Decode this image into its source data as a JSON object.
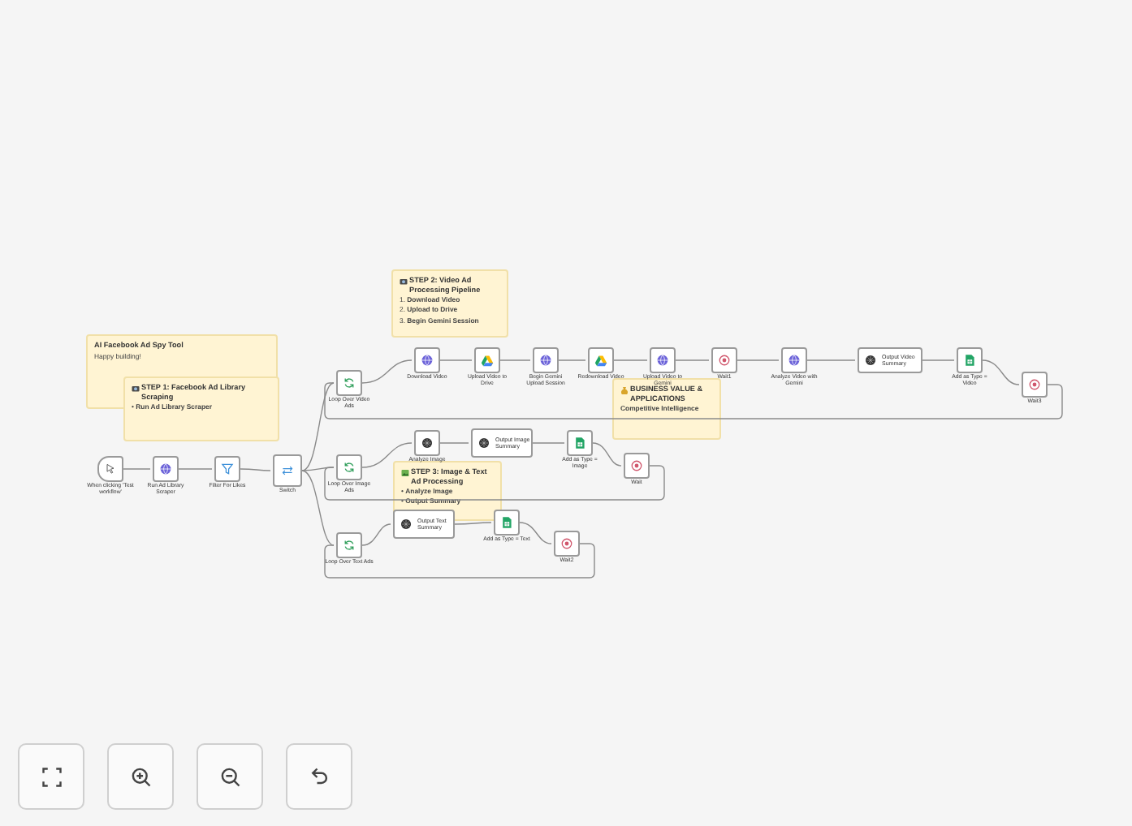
{
  "canvas": {
    "sticky_notes": [
      {
        "title": "AI Facebook Ad Spy Tool",
        "lines": [
          "Happy building!"
        ]
      },
      {
        "title": "STEP 1: Facebook Ad Library Scraping",
        "lines": [
          "• **Run Ad Library Scraper**"
        ]
      },
      {
        "title": "STEP 2: Video Ad Processing Pipeline",
        "lines": [
          "1. **Download Video**",
          "2. **Upload to Drive**",
          "3. **Begin Gemini Session**"
        ]
      },
      {
        "title": "BUSINESS VALUE & APPLICATIONS",
        "lines": [
          "**Competitive Intelligence**"
        ]
      },
      {
        "title": "STEP 3: Image & Text Ad Processing",
        "lines": [
          "• **Analyze Image**",
          "• **Output Summary**"
        ]
      }
    ],
    "nodes": [
      {
        "label": "When clicking 'Test workflow'",
        "kind": "trigger"
      },
      {
        "label": "Run Ad Library Scraper",
        "kind": "http"
      },
      {
        "label": "Filter For Likes",
        "kind": "filter"
      },
      {
        "label": "Switch",
        "kind": "switch"
      },
      {
        "label": "Loop Over Video Ads",
        "kind": "loop"
      },
      {
        "label": "Loop Over Image Ads",
        "kind": "loop"
      },
      {
        "label": "Loop Over Text Ads",
        "kind": "loop"
      },
      {
        "label": "Download Video",
        "kind": "http"
      },
      {
        "label": "Upload Video to Drive",
        "kind": "drive"
      },
      {
        "label": "Begin Gemini Upload Session",
        "kind": "http"
      },
      {
        "label": "Redownload Video",
        "kind": "drive"
      },
      {
        "label": "Upload Video to Gemini",
        "kind": "http"
      },
      {
        "label": "Wait1",
        "kind": "wait"
      },
      {
        "label": "Analyze Video with Gemini",
        "kind": "http"
      },
      {
        "label": "Output Video Summary",
        "kind": "ai"
      },
      {
        "label": "Add as Type = Video",
        "kind": "sheets"
      },
      {
        "label": "Wait3",
        "kind": "wait"
      },
      {
        "label": "Analyze Image",
        "kind": "ai"
      },
      {
        "label": "Output Image Summary",
        "kind": "ai"
      },
      {
        "label": "Add as Type = Image",
        "kind": "sheets"
      },
      {
        "label": "Wait",
        "kind": "wait"
      },
      {
        "label": "Output Text Summary",
        "kind": "ai"
      },
      {
        "label": "Add as Type = Text",
        "kind": "sheets"
      },
      {
        "label": "Wait2",
        "kind": "wait"
      }
    ]
  },
  "controls": [
    {
      "kind": "fit"
    },
    {
      "kind": "zoom_in"
    },
    {
      "kind": "zoom_out"
    },
    {
      "kind": "undo"
    }
  ]
}
